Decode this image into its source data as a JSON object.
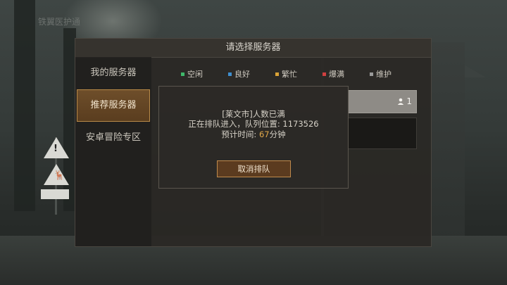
{
  "watermark": "铁翼医护通",
  "dialog": {
    "title": "请选择服务器",
    "sidebar": [
      {
        "label": "我的服务器",
        "active": false
      },
      {
        "label": "推荐服务器",
        "active": true
      },
      {
        "label": "安卓冒险专区",
        "active": false
      }
    ],
    "legend": [
      {
        "label": "空闲",
        "color": "#3fb86a"
      },
      {
        "label": "良好",
        "color": "#3f8fd0"
      },
      {
        "label": "繁忙",
        "color": "#d9a236"
      },
      {
        "label": "爆满",
        "color": "#d04040"
      },
      {
        "label": "维护",
        "color": "#9a9a9a"
      }
    ],
    "server": {
      "count": "1",
      "icon": "user-icon"
    }
  },
  "queue": {
    "status": "[莱文市]人数已满",
    "line2_prefix": "正在排队进入，队列位置: ",
    "position": "1173526",
    "eta_prefix": "预计时间: ",
    "eta_value": "67",
    "eta_unit": "分钟",
    "cancel_label": "取消排队"
  }
}
